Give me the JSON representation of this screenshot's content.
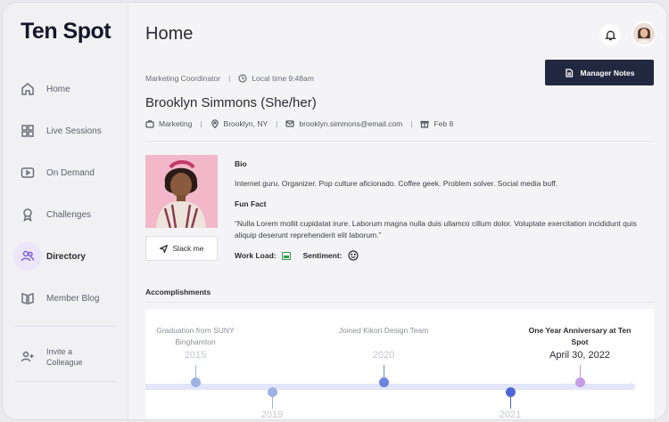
{
  "app": {
    "logo": "Ten Spot"
  },
  "sidebar": {
    "items": [
      {
        "label": "Home",
        "icon": "home-icon"
      },
      {
        "label": "Live Sessions",
        "icon": "grid-icon"
      },
      {
        "label": "On Demand",
        "icon": "play-icon"
      },
      {
        "label": "Challenges",
        "icon": "award-icon"
      },
      {
        "label": "Directory",
        "icon": "users-icon"
      },
      {
        "label": "Member Blog",
        "icon": "book-icon"
      }
    ],
    "invite_label": "Invite a Colleague"
  },
  "header": {
    "title": "Home"
  },
  "profile": {
    "role": "Marketing Coordinator",
    "local_time": "Local time 9:48am",
    "manager_notes_label": "Manager Notes",
    "name": "Brooklyn Simmons (She/her)",
    "department": "Marketing",
    "location": "Brooklyn, NY",
    "email": "brooklyn.simmons@email.com",
    "birthday": "Feb 8",
    "slack_label": "Slack me",
    "bio_heading": "Bio",
    "bio_text": "Internet guru. Organizer. Pop culture aficionado. Coffee geek. Problem solver. Social media buff.",
    "fun_fact_heading": "Fun Fact",
    "fun_fact_text": "“Nulla Lorem mollit cupidatat irure. Laborum magna nulla duis ullamco cillum dolor. Voluptate exercitation incididunt quis aliquip deserunt reprehenderit elit laborum.”",
    "workload_label": "Work Load:",
    "sentiment_label": "Sentiment:"
  },
  "accomplishments": {
    "heading": "Accomplishments",
    "events": [
      {
        "title": "Graduation from SUNY Binghamton",
        "year": "2015",
        "color": "#9fb2e6"
      },
      {
        "title": "",
        "year": "2019",
        "color": "#9fb2e6"
      },
      {
        "title": "Joined Kikori Design Team",
        "year": "2020",
        "color": "#6f84dd"
      },
      {
        "title": "",
        "year": "2021",
        "color": "#4f67d4"
      },
      {
        "title": "One Year Anniversary at Ten Spot",
        "year": "April 30, 2022",
        "color": "#c49be6"
      }
    ]
  },
  "colors": {
    "accent": "#7b61d6",
    "button_dark": "#232841",
    "workload_green": "#2f9b4a"
  }
}
